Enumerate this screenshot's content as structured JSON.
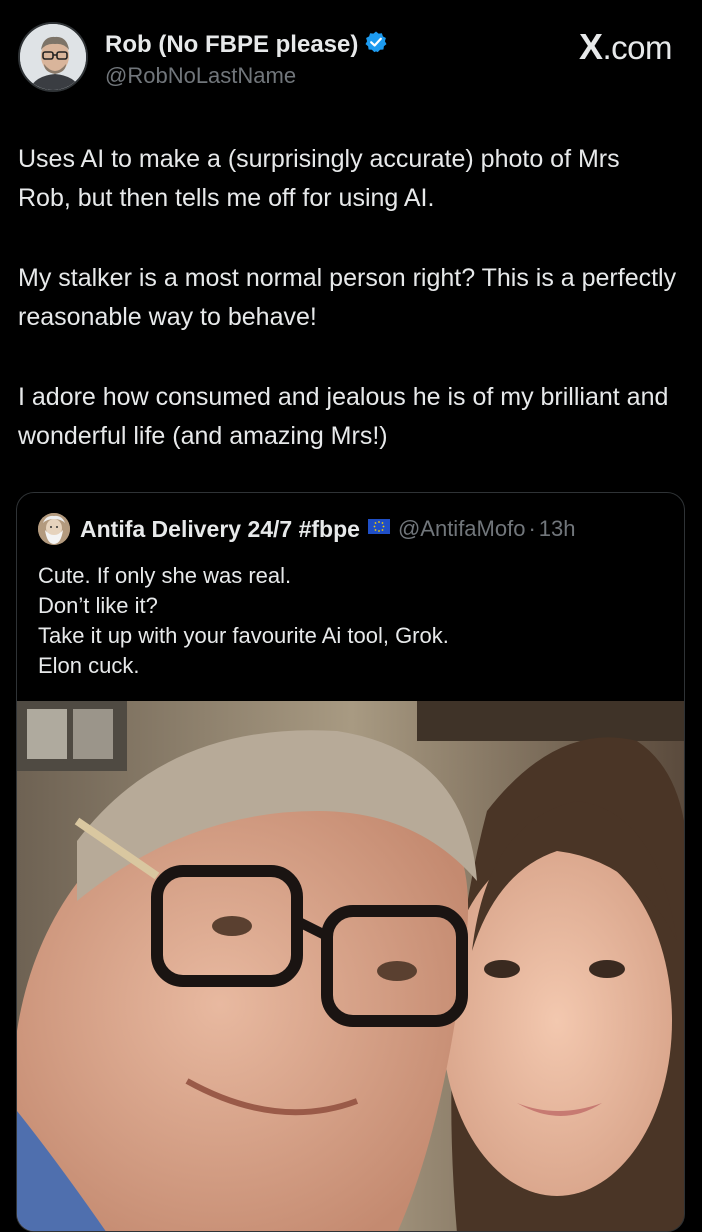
{
  "author": {
    "display_name": "Rob (No FBPE please)",
    "handle": "@RobNoLastName",
    "verified_icon": "verified-badge-icon"
  },
  "site": {
    "label": ".com",
    "logo_letter": "X"
  },
  "tweet": {
    "paragraphs": [
      "Uses AI to make a (surprisingly accurate) photo of Mrs Rob, but then tells me off for using AI.",
      "My stalker is a most normal person right? This is a perfectly reasonable way to behave!",
      "I adore how consumed and jealous he is of my brilliant and wonderful life (and amazing Mrs!)"
    ]
  },
  "quote": {
    "display_name": "Antifa Delivery 24/7 #fbpe",
    "flag_icon": "eu-flag-icon",
    "handle": "@AntifaMofo",
    "separator": "·",
    "time": "13h",
    "lines": [
      "Cute. If only she was real.",
      "Don’t like it?",
      "Take it up with your favourite Ai tool, Grok.",
      "Elon cuck."
    ]
  },
  "colors": {
    "background": "#000000",
    "text": "#e7e9ea",
    "secondary": "#71767b",
    "verified": "#1d9bf0",
    "border": "#2f3336"
  }
}
